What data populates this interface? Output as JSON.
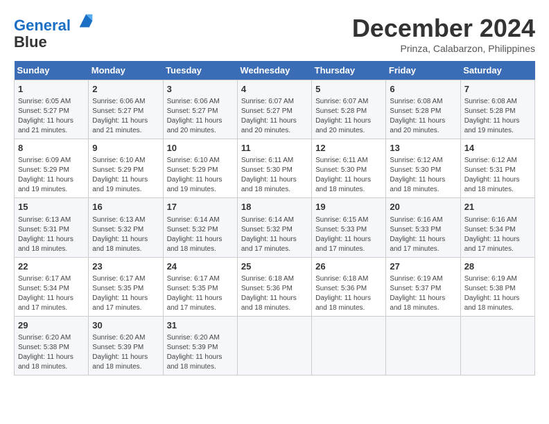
{
  "header": {
    "logo_line1": "General",
    "logo_line2": "Blue",
    "month_title": "December 2024",
    "subtitle": "Prinza, Calabarzon, Philippines"
  },
  "weekdays": [
    "Sunday",
    "Monday",
    "Tuesday",
    "Wednesday",
    "Thursday",
    "Friday",
    "Saturday"
  ],
  "weeks": [
    [
      {
        "day": "1",
        "info": "Sunrise: 6:05 AM\nSunset: 5:27 PM\nDaylight: 11 hours\nand 21 minutes."
      },
      {
        "day": "2",
        "info": "Sunrise: 6:06 AM\nSunset: 5:27 PM\nDaylight: 11 hours\nand 21 minutes."
      },
      {
        "day": "3",
        "info": "Sunrise: 6:06 AM\nSunset: 5:27 PM\nDaylight: 11 hours\nand 20 minutes."
      },
      {
        "day": "4",
        "info": "Sunrise: 6:07 AM\nSunset: 5:27 PM\nDaylight: 11 hours\nand 20 minutes."
      },
      {
        "day": "5",
        "info": "Sunrise: 6:07 AM\nSunset: 5:28 PM\nDaylight: 11 hours\nand 20 minutes."
      },
      {
        "day": "6",
        "info": "Sunrise: 6:08 AM\nSunset: 5:28 PM\nDaylight: 11 hours\nand 20 minutes."
      },
      {
        "day": "7",
        "info": "Sunrise: 6:08 AM\nSunset: 5:28 PM\nDaylight: 11 hours\nand 19 minutes."
      }
    ],
    [
      {
        "day": "8",
        "info": "Sunrise: 6:09 AM\nSunset: 5:29 PM\nDaylight: 11 hours\nand 19 minutes."
      },
      {
        "day": "9",
        "info": "Sunrise: 6:10 AM\nSunset: 5:29 PM\nDaylight: 11 hours\nand 19 minutes."
      },
      {
        "day": "10",
        "info": "Sunrise: 6:10 AM\nSunset: 5:29 PM\nDaylight: 11 hours\nand 19 minutes."
      },
      {
        "day": "11",
        "info": "Sunrise: 6:11 AM\nSunset: 5:30 PM\nDaylight: 11 hours\nand 18 minutes."
      },
      {
        "day": "12",
        "info": "Sunrise: 6:11 AM\nSunset: 5:30 PM\nDaylight: 11 hours\nand 18 minutes."
      },
      {
        "day": "13",
        "info": "Sunrise: 6:12 AM\nSunset: 5:30 PM\nDaylight: 11 hours\nand 18 minutes."
      },
      {
        "day": "14",
        "info": "Sunrise: 6:12 AM\nSunset: 5:31 PM\nDaylight: 11 hours\nand 18 minutes."
      }
    ],
    [
      {
        "day": "15",
        "info": "Sunrise: 6:13 AM\nSunset: 5:31 PM\nDaylight: 11 hours\nand 18 minutes."
      },
      {
        "day": "16",
        "info": "Sunrise: 6:13 AM\nSunset: 5:32 PM\nDaylight: 11 hours\nand 18 minutes."
      },
      {
        "day": "17",
        "info": "Sunrise: 6:14 AM\nSunset: 5:32 PM\nDaylight: 11 hours\nand 18 minutes."
      },
      {
        "day": "18",
        "info": "Sunrise: 6:14 AM\nSunset: 5:32 PM\nDaylight: 11 hours\nand 17 minutes."
      },
      {
        "day": "19",
        "info": "Sunrise: 6:15 AM\nSunset: 5:33 PM\nDaylight: 11 hours\nand 17 minutes."
      },
      {
        "day": "20",
        "info": "Sunrise: 6:16 AM\nSunset: 5:33 PM\nDaylight: 11 hours\nand 17 minutes."
      },
      {
        "day": "21",
        "info": "Sunrise: 6:16 AM\nSunset: 5:34 PM\nDaylight: 11 hours\nand 17 minutes."
      }
    ],
    [
      {
        "day": "22",
        "info": "Sunrise: 6:17 AM\nSunset: 5:34 PM\nDaylight: 11 hours\nand 17 minutes."
      },
      {
        "day": "23",
        "info": "Sunrise: 6:17 AM\nSunset: 5:35 PM\nDaylight: 11 hours\nand 17 minutes."
      },
      {
        "day": "24",
        "info": "Sunrise: 6:17 AM\nSunset: 5:35 PM\nDaylight: 11 hours\nand 17 minutes."
      },
      {
        "day": "25",
        "info": "Sunrise: 6:18 AM\nSunset: 5:36 PM\nDaylight: 11 hours\nand 18 minutes."
      },
      {
        "day": "26",
        "info": "Sunrise: 6:18 AM\nSunset: 5:36 PM\nDaylight: 11 hours\nand 18 minutes."
      },
      {
        "day": "27",
        "info": "Sunrise: 6:19 AM\nSunset: 5:37 PM\nDaylight: 11 hours\nand 18 minutes."
      },
      {
        "day": "28",
        "info": "Sunrise: 6:19 AM\nSunset: 5:38 PM\nDaylight: 11 hours\nand 18 minutes."
      }
    ],
    [
      {
        "day": "29",
        "info": "Sunrise: 6:20 AM\nSunset: 5:38 PM\nDaylight: 11 hours\nand 18 minutes."
      },
      {
        "day": "30",
        "info": "Sunrise: 6:20 AM\nSunset: 5:39 PM\nDaylight: 11 hours\nand 18 minutes."
      },
      {
        "day": "31",
        "info": "Sunrise: 6:20 AM\nSunset: 5:39 PM\nDaylight: 11 hours\nand 18 minutes."
      },
      null,
      null,
      null,
      null
    ]
  ]
}
